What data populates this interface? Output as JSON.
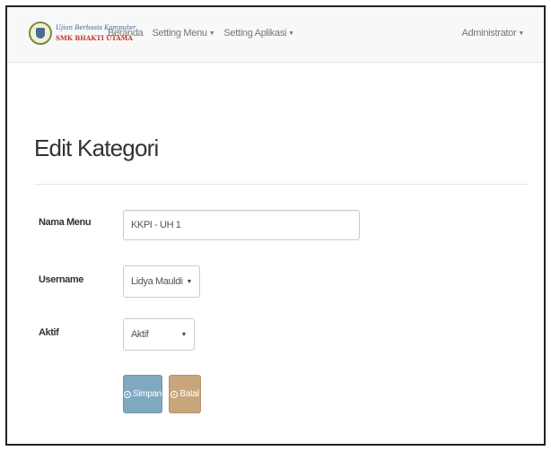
{
  "brand": {
    "line1": "Ujian Berbasis Komputer",
    "line2": "SMK BHAKTI UTAMA"
  },
  "nav": {
    "items": [
      {
        "label": "Beranda",
        "has_caret": false
      },
      {
        "label": "Setting Menu",
        "has_caret": true
      },
      {
        "label": "Setting Aplikasi",
        "has_caret": true
      }
    ],
    "user_menu": "Administrator"
  },
  "page": {
    "title": "Edit Kategori"
  },
  "form": {
    "nama_menu": {
      "label": "Nama Menu",
      "value": "KKPI - UH 1"
    },
    "username": {
      "label": "Username",
      "selected": "Lidya Mauldiny, S.I"
    },
    "aktif": {
      "label": "Aktif",
      "selected": "Aktif"
    },
    "buttons": {
      "save": "Simpan",
      "cancel": "Batal"
    }
  },
  "colors": {
    "save_button": "#7fa9c0",
    "cancel_button": "#c9a57c",
    "navbar_bg": "#f8f8f8"
  },
  "icons": {
    "save": "check-circle-icon",
    "cancel": "close-circle-icon",
    "dropdown": "caret-down-icon"
  }
}
